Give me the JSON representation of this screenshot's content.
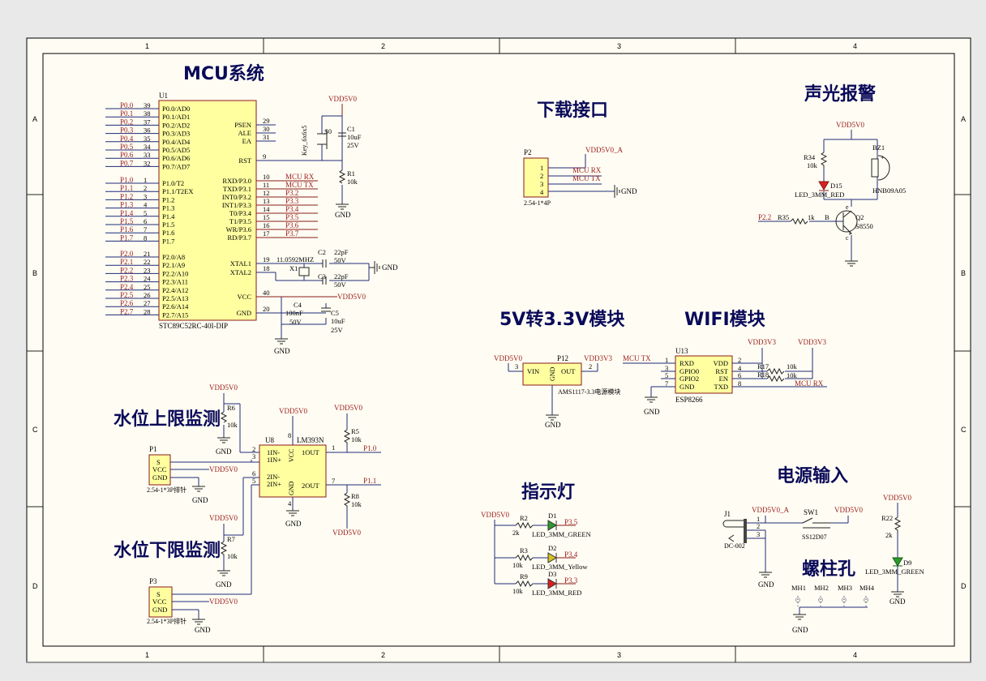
{
  "titles": {
    "mcu": "MCU系统",
    "download": "下载接口",
    "alarm": "声光报警",
    "regulator": "5V转3.3V模块",
    "wifi": "WIFI模块",
    "upper": "水位上限监测",
    "lower": "水位下限监测",
    "indicator": "指示灯",
    "power": "电源输入",
    "holes": "螺柱孔"
  },
  "zones": {
    "cols": [
      "1",
      "2",
      "3",
      "4"
    ],
    "rows": [
      "A",
      "B",
      "C",
      "D"
    ]
  },
  "mcu": {
    "ref": "U1",
    "part": "STC89C52RC-40I-DIP",
    "left_pins": [
      {
        "net": "P0.0",
        "num": "39",
        "name": "P0.0/AD0"
      },
      {
        "net": "P0.1",
        "num": "38",
        "name": "P0.1/AD1"
      },
      {
        "net": "P0.2",
        "num": "37",
        "name": "P0.2/AD2"
      },
      {
        "net": "P0.3",
        "num": "36",
        "name": "P0.3/AD3"
      },
      {
        "net": "P0.4",
        "num": "35",
        "name": "P0.4/AD4"
      },
      {
        "net": "P0.5",
        "num": "34",
        "name": "P0.5/AD5"
      },
      {
        "net": "P0.6",
        "num": "33",
        "name": "P0.6/AD6"
      },
      {
        "net": "P0.7",
        "num": "32",
        "name": "P0.7/AD7"
      },
      {
        "net": "P1.0",
        "num": "1",
        "name": "P1.0/T2"
      },
      {
        "net": "P1.1",
        "num": "2",
        "name": "P1.1/T2EX"
      },
      {
        "net": "P1.2",
        "num": "3",
        "name": "P1.2"
      },
      {
        "net": "P1.3",
        "num": "4",
        "name": "P1.3"
      },
      {
        "net": "P1.4",
        "num": "5",
        "name": "P1.4"
      },
      {
        "net": "P1.5",
        "num": "6",
        "name": "P1.5"
      },
      {
        "net": "P1.6",
        "num": "7",
        "name": "P1.6"
      },
      {
        "net": "P1.7",
        "num": "8",
        "name": "P1.7"
      },
      {
        "net": "P2.0",
        "num": "21",
        "name": "P2.0/A8"
      },
      {
        "net": "P2.1",
        "num": "22",
        "name": "P2.1/A9"
      },
      {
        "net": "P2.2",
        "num": "23",
        "name": "P2.2/A10"
      },
      {
        "net": "P2.3",
        "num": "24",
        "name": "P2.3/A11"
      },
      {
        "net": "P2.4",
        "num": "25",
        "name": "P2.4/A12"
      },
      {
        "net": "P2.5",
        "num": "26",
        "name": "P2.5/A13"
      },
      {
        "net": "P2.6",
        "num": "27",
        "name": "P2.6/A14"
      },
      {
        "net": "P2.7",
        "num": "28",
        "name": "P2.7/A15"
      }
    ],
    "right_pins": [
      {
        "name": "PSEN",
        "num": "29",
        "net": ""
      },
      {
        "name": "ALE",
        "num": "30",
        "net": ""
      },
      {
        "name": "EA",
        "num": "31",
        "net": ""
      },
      {
        "name": "RST",
        "num": "9",
        "net": ""
      },
      {
        "name": "RXD/P3.0",
        "num": "10",
        "net": "MCU RX"
      },
      {
        "name": "TXD/P3.1",
        "num": "11",
        "net": "MCU TX"
      },
      {
        "name": "INT0/P3.2",
        "num": "12",
        "net": "P3.2"
      },
      {
        "name": "INT1/P3.3",
        "num": "13",
        "net": "P3.3"
      },
      {
        "name": "T0/P3.4",
        "num": "14",
        "net": "P3.4"
      },
      {
        "name": "T1/P3.5",
        "num": "15",
        "net": "P3.5"
      },
      {
        "name": "WR/P3.6",
        "num": "16",
        "net": "P3.6"
      },
      {
        "name": "RD/P3.7",
        "num": "17",
        "net": "P3.7"
      },
      {
        "name": "XTAL1",
        "num": "19",
        "net": ""
      },
      {
        "name": "XTAL2",
        "num": "18",
        "net": ""
      },
      {
        "name": "VCC",
        "num": "40",
        "net": "VDD5V0"
      },
      {
        "name": "GND",
        "num": "20",
        "net": ""
      }
    ],
    "vdd": "VDD5V0",
    "gnd": "GND",
    "s0": "S0",
    "s0_part": "Key_6x6x5",
    "c1": "C1",
    "c1_val": "10uF",
    "c1_v": "25V",
    "r1": "R1",
    "r1_val": "10k",
    "c2": "C2",
    "c2_val": "22pF",
    "c2_v": "50V",
    "c3": "C3",
    "c3_val": "22pF",
    "c3_v": "50V",
    "x1": "X1",
    "x1_val": "11.0592MHZ",
    "c4": "C4",
    "c4_val": "100nF",
    "c4_v": "50V",
    "c5": "C5",
    "c5_val": "10uF",
    "c5_v": "25V"
  },
  "download": {
    "ref": "P2",
    "part": "2.54-1*4P",
    "pins": [
      "1",
      "2",
      "3",
      "4"
    ],
    "vdd": "VDD5V0_A",
    "rx": "MCU RX",
    "tx": "MCU TX",
    "gnd": "GND"
  },
  "alarm": {
    "vdd": "VDD5V0",
    "r34": "R34",
    "r34_val": "10k",
    "d15": "D15",
    "d15_part": "LED_3MM_RED",
    "bz": "BZ1",
    "bz_part": "HNB09A05",
    "r35": "R35",
    "r35_val": "1k",
    "net": "P2.2",
    "b": "B",
    "q": "Q2",
    "q_part": "S8550",
    "e": "e",
    "c": "c"
  },
  "regulator": {
    "vin_net": "VDD5V0",
    "vout_net": "VDD3V3",
    "ref": "P12",
    "vin": "VIN",
    "gnd": "GND",
    "out": "OUT",
    "pin_in": "3",
    "pin_out": "2",
    "part": "AMS1117-3.3电源模块",
    "gnd_label": "GND"
  },
  "wifi": {
    "ref": "U13",
    "part": "ESP8266",
    "vdd_a": "VDD3V3",
    "vdd_b": "VDD3V3",
    "tx_net": "MCU TX",
    "rx_net": "MCU RX",
    "left": [
      {
        "num": "1",
        "name": "RXD"
      },
      {
        "num": "3",
        "name": "GPIO0"
      },
      {
        "num": "5",
        "name": "GPIO2"
      },
      {
        "num": "7",
        "name": "GND"
      }
    ],
    "right": [
      {
        "num": "2",
        "name": "VDD"
      },
      {
        "num": "4",
        "name": "RST"
      },
      {
        "num": "6",
        "name": "EN"
      },
      {
        "num": "8",
        "name": "TXD"
      }
    ],
    "r17": "R17",
    "r18": "R18",
    "r_val": "10k",
    "gnd": "GND"
  },
  "sensors": {
    "u8": "U8",
    "u8_part": "LM393N",
    "vdd": "VDD5V0",
    "gnd": "GND",
    "pins": {
      "in1m": "1IN-",
      "in1p": "1IN+",
      "in2m": "2IN-",
      "in2p": "2IN+",
      "out1": "1OUT",
      "out2": "2OUT",
      "vcc": "VCC",
      "g": "GND"
    },
    "nums": {
      "p2": "2",
      "p3": "3",
      "p6": "6",
      "p5": "5",
      "p1": "1",
      "p7": "7",
      "p8": "8",
      "p4": "4"
    },
    "r6": "R6",
    "r7": "R7",
    "r5": "R5",
    "r8": "R8",
    "rv": "10k",
    "p1_net": "P1.0",
    "p2_net": "P1.1",
    "p1": "P1",
    "p3": "P3",
    "conn_part": "2.54-1*3P排针",
    "s": "S",
    "vcc": "VCC",
    "g": "GND"
  },
  "indicator": {
    "vdd": "VDD5V0",
    "leds": [
      {
        "r": "R2",
        "rv": "2k",
        "d": "D1",
        "part": "LED_3MM_GREEN",
        "net": "P3.5",
        "color": "#2a9a2a"
      },
      {
        "r": "R3",
        "rv": "10k",
        "d": "D2",
        "part": "LED_3MM_Yellow",
        "net": "P3.4",
        "color": "#d8c020"
      },
      {
        "r": "R9",
        "rv": "10k",
        "d": "D3",
        "part": "LED_3MM_RED",
        "net": "P3.3",
        "color": "#d82020"
      }
    ]
  },
  "power": {
    "j1": "J1",
    "j1_part": "DC-002",
    "vdd_a": "VDD5V0_A",
    "sw": "SW1",
    "sw_part": "SS12D07",
    "vdd": "VDD5V0",
    "gnd": "GND",
    "pins": [
      "1",
      "2",
      "3"
    ],
    "r22": "R22",
    "r22_val": "2k",
    "d9": "D9",
    "d9_part": "LED_3MM_GREEN",
    "vdd2": "VDD5V0",
    "gnd2": "GND"
  },
  "holes": {
    "items": [
      "MH1",
      "MH2",
      "MH3",
      "MH4"
    ],
    "gnd": "GND"
  }
}
